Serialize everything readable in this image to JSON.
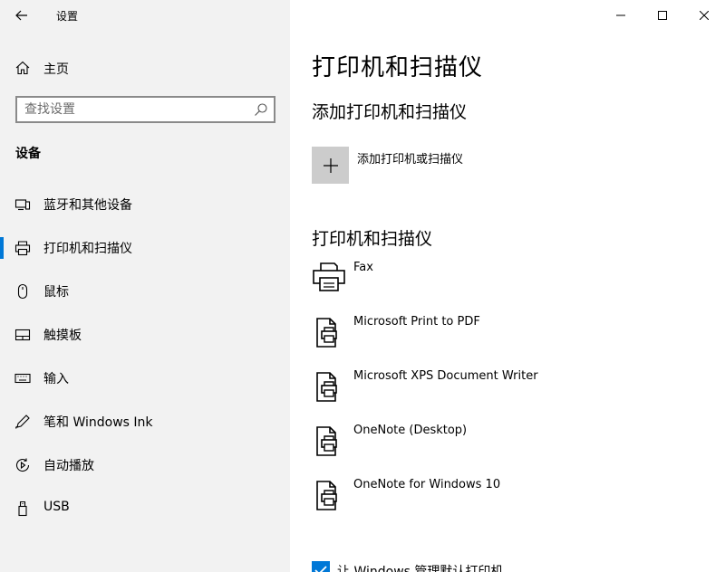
{
  "window": {
    "title": "设置",
    "controls": [
      "minimize-icon",
      "maximize-icon",
      "close-icon"
    ]
  },
  "sidebar": {
    "home_label": "主页",
    "search_placeholder": "查找设置",
    "section_label": "设备",
    "items": [
      {
        "label": "蓝牙和其他设备",
        "icon": "bluetooth-devices-icon",
        "active": false
      },
      {
        "label": "打印机和扫描仪",
        "icon": "printer-icon",
        "active": true
      },
      {
        "label": "鼠标",
        "icon": "mouse-icon",
        "active": false
      },
      {
        "label": "触摸板",
        "icon": "touchpad-icon",
        "active": false
      },
      {
        "label": "输入",
        "icon": "keyboard-icon",
        "active": false
      },
      {
        "label": "笔和 Windows Ink",
        "icon": "pen-icon",
        "active": false
      },
      {
        "label": "自动播放",
        "icon": "autoplay-icon",
        "active": false
      },
      {
        "label": "USB",
        "icon": "usb-icon",
        "active": false
      }
    ]
  },
  "main": {
    "page_title": "打印机和扫描仪",
    "add_section_title": "添加打印机和扫描仪",
    "add_button_label": "添加打印机或扫描仪",
    "list_section_title": "打印机和扫描仪",
    "printers": [
      {
        "name": "Fax",
        "icon": "fax-printer-icon"
      },
      {
        "name": "Microsoft Print to PDF",
        "icon": "document-printer-icon"
      },
      {
        "name": "Microsoft XPS Document Writer",
        "icon": "document-printer-icon"
      },
      {
        "name": "OneNote (Desktop)",
        "icon": "document-printer-icon"
      },
      {
        "name": "OneNote for Windows 10",
        "icon": "document-printer-icon"
      }
    ],
    "default_printer_checkbox": {
      "label": "让 Windows 管理默认打印机",
      "checked": true
    }
  },
  "colors": {
    "accent": "#0078d7",
    "sidebar_bg": "#f2f2f2",
    "add_button_bg": "#cccccc"
  }
}
